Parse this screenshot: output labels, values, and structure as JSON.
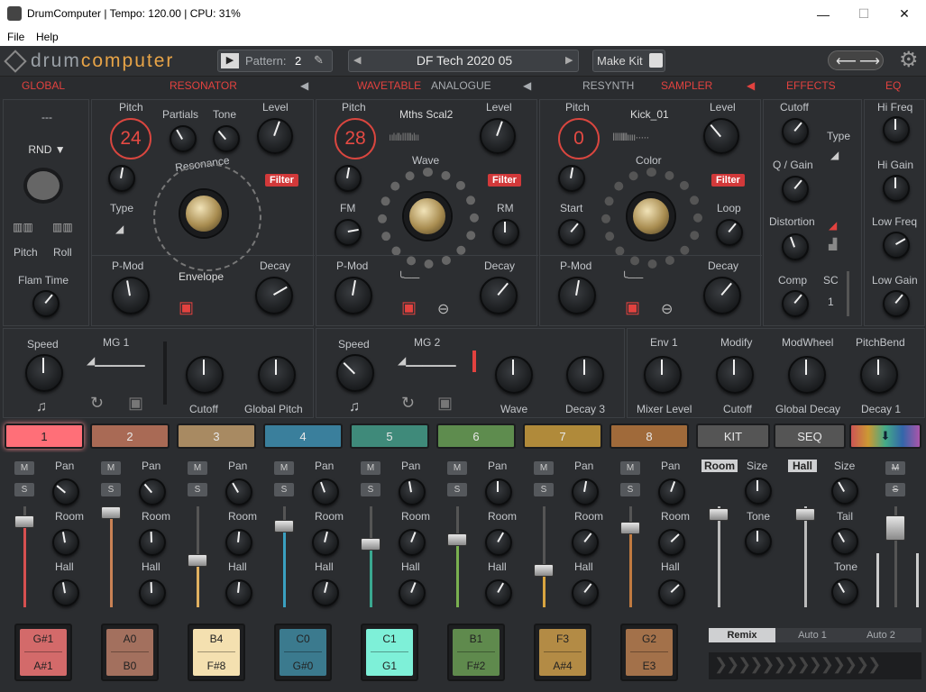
{
  "window": {
    "title": "DrumComputer | Tempo: 120.00 | CPU: 31%",
    "minimize": "—",
    "maximize": "☐",
    "close": "✕"
  },
  "menu": [
    "File",
    "Help"
  ],
  "topbar": {
    "logo_a": "drum",
    "logo_b": "computer",
    "pattern_label": "Pattern:",
    "pattern_value": "2",
    "preset_name": "DF Tech 2020 05",
    "make_kit": "Make Kit"
  },
  "sections": {
    "global": "GLOBAL",
    "resonator": "RESONATOR",
    "wavetable": "WAVETABLE",
    "analogue": "ANALOGUE",
    "resynth": "RESYNTH",
    "sampler": "SAMPLER",
    "effects": "EFFECTS",
    "eq": "EQ"
  },
  "global": {
    "top": "---",
    "rnd": "RND ▼",
    "pitch": "Pitch",
    "roll": "Roll",
    "flam": "Flam Time"
  },
  "resonator": {
    "pitch": "Pitch",
    "pitch_value": "24",
    "partials": "Partials",
    "tone": "Tone",
    "level": "Level",
    "filter": "Filter",
    "resonance": "Resonance",
    "type": "Type",
    "pmod": "P-Mod",
    "envelope": "Envelope",
    "decay": "Decay"
  },
  "wavetable": {
    "pitch": "Pitch",
    "pitch_value": "28",
    "name": "Mths Scal2",
    "level": "Level",
    "wave": "Wave",
    "filter": "Filter",
    "fm": "FM",
    "rm": "RM",
    "pmod": "P-Mod",
    "decay": "Decay"
  },
  "sampler": {
    "pitch": "Pitch",
    "pitch_value": "0",
    "name": "Kick_01",
    "level": "Level",
    "color": "Color",
    "filter": "Filter",
    "start": "Start",
    "loop": "Loop",
    "pmod": "P-Mod",
    "decay": "Decay"
  },
  "effects": {
    "cutoff": "Cutoff",
    "type": "Type",
    "qgain": "Q / Gain",
    "distortion": "Distortion",
    "comp": "Comp",
    "sc": "SC",
    "sc_value": "1"
  },
  "eq": {
    "hifreq": "Hi Freq",
    "higain": "Hi Gain",
    "lowfreq": "Low Freq",
    "lowgain": "Low Gain"
  },
  "mod": {
    "mg1": {
      "speed": "Speed",
      "title": "MG 1",
      "t1": "Cutoff",
      "t2": "Global Pitch"
    },
    "mg2": {
      "speed": "Speed",
      "title": "MG 2",
      "t1": "Wave",
      "t2": "Decay 3"
    },
    "macros": [
      {
        "top": "Env 1",
        "bottom": "Mixer Level"
      },
      {
        "top": "Modify",
        "bottom": "Cutoff"
      },
      {
        "top": "ModWheel",
        "bottom": "Global Decay"
      },
      {
        "top": "PitchBend",
        "bottom": "Decay 1"
      }
    ]
  },
  "tabs": [
    "1",
    "2",
    "3",
    "4",
    "5",
    "6",
    "7",
    "8",
    "KIT",
    "SEQ"
  ],
  "tab_colors": [
    "#ff6f78",
    "#a96a55",
    "#a88a62",
    "#3a7f9c",
    "#3f8a7a",
    "#5e8c4e",
    "#b08a3a",
    "#a06a3a",
    "#555",
    "#555"
  ],
  "mixer": {
    "mute": "M",
    "solo": "S",
    "pan": "Pan",
    "room": "Room",
    "hall": "Hall",
    "room_bus": {
      "title": "Room",
      "size": "Size",
      "tone": "Tone"
    },
    "hall_bus": {
      "title": "Hall",
      "size": "Size",
      "tail": "Tail",
      "tone": "Tone"
    }
  },
  "pads": [
    {
      "top": "G#1",
      "bottom": "A#1",
      "color": "#d36a6a"
    },
    {
      "top": "A0",
      "bottom": "B0",
      "color": "#a3705e"
    },
    {
      "top": "B4",
      "bottom": "F#8",
      "color": "#f4e0b0"
    },
    {
      "top": "C0",
      "bottom": "G#0",
      "color": "#3b7a8e"
    },
    {
      "top": "C1",
      "bottom": "G1",
      "color": "#7ef0d8"
    },
    {
      "top": "B1",
      "bottom": "F#2",
      "color": "#5f8a4d"
    },
    {
      "top": "F3",
      "bottom": "A#4",
      "color": "#b38b45"
    },
    {
      "top": "G2",
      "bottom": "E3",
      "color": "#a3714a"
    }
  ],
  "remix": {
    "remix": "Remix",
    "auto1": "Auto 1",
    "auto2": "Auto 2"
  }
}
